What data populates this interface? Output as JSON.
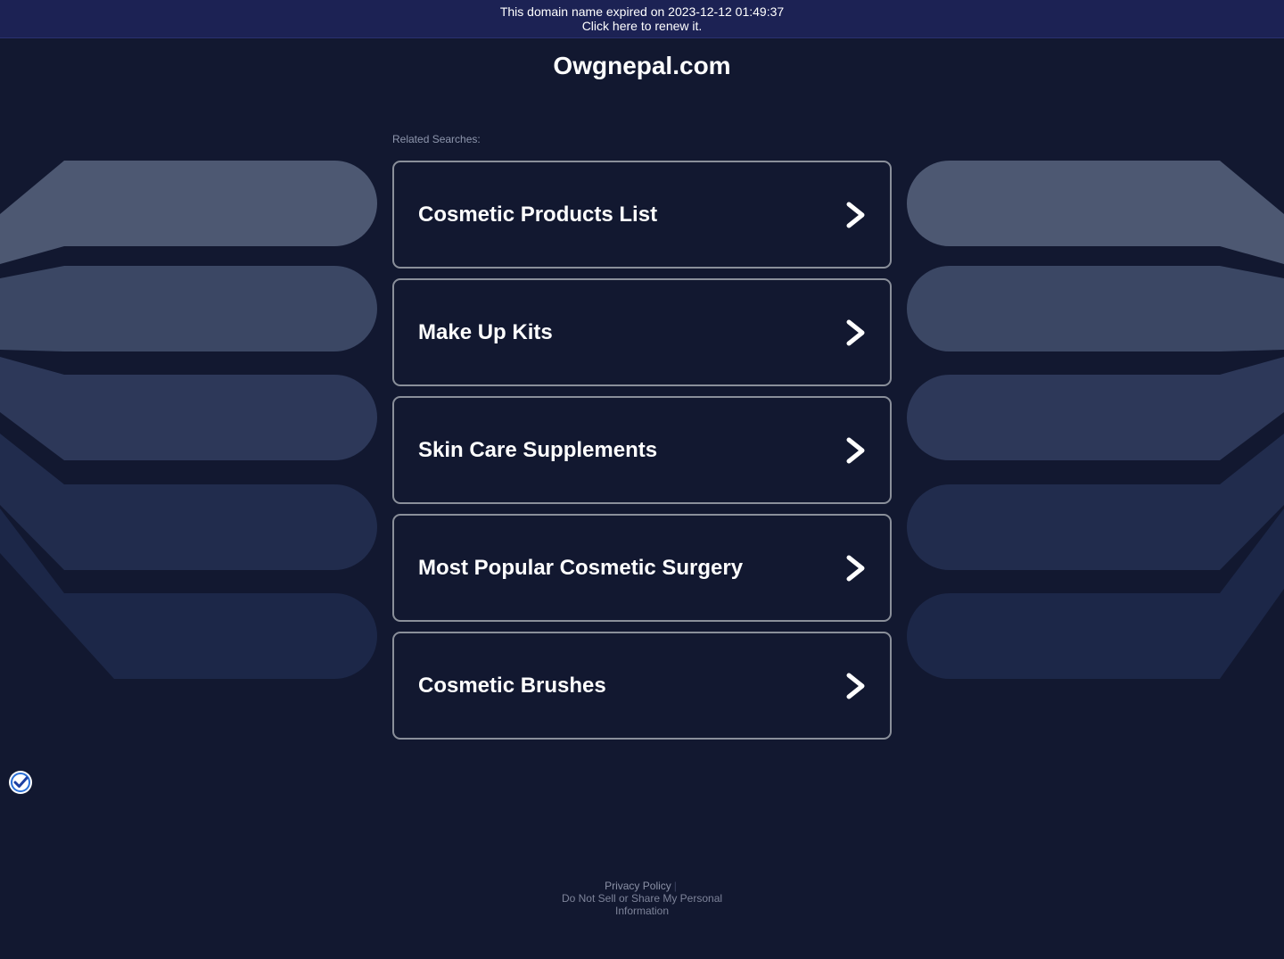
{
  "banner": {
    "expired_text": "This domain name expired on 2023-12-12 01:49:37",
    "renew_text": "Click here to renew it."
  },
  "site": {
    "title": "Owgnepal.com"
  },
  "related": {
    "label": "Related Searches:",
    "items": [
      {
        "label": "Cosmetic Products List"
      },
      {
        "label": "Make Up Kits"
      },
      {
        "label": "Skin Care Supplements"
      },
      {
        "label": "Most Popular Cosmetic Surgery"
      },
      {
        "label": "Cosmetic Brushes"
      }
    ]
  },
  "footer": {
    "privacy_label": "Privacy Policy",
    "separator": "|",
    "do_not_sell_label": "Do Not Sell or Share My Personal Information"
  },
  "icons": {
    "row_arrow": "chevron-right-icon",
    "badge": "checkmark-badge-icon"
  },
  "colors": {
    "background": "#121830",
    "banner": "#1c2254",
    "button_border": "#8a8f9a",
    "text": "#ffffff"
  }
}
